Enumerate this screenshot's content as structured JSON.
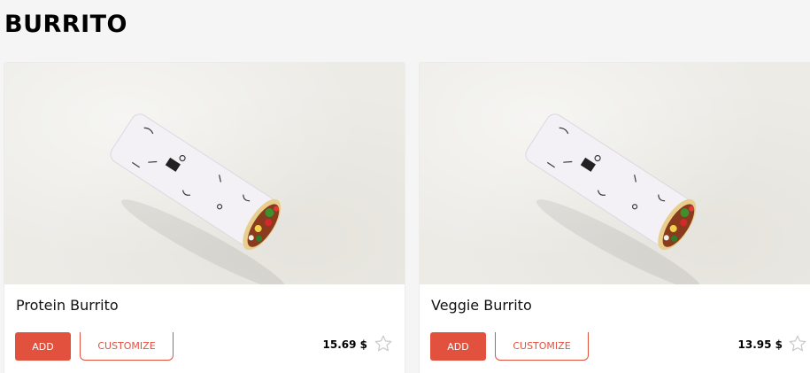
{
  "section": {
    "title": "BURRITO"
  },
  "products": [
    {
      "name": "Protein Burrito",
      "add_label": "ADD",
      "customize_label": "CUSTOMIZE",
      "price": "15.69 $",
      "image_alt": "burrito-photo",
      "favorite_icon": "star-outline-icon"
    },
    {
      "name": "Veggie Burrito",
      "add_label": "ADD",
      "customize_label": "CUSTOMIZE",
      "price": "13.95 $",
      "image_alt": "burrito-photo",
      "favorite_icon": "star-outline-icon"
    }
  ],
  "colors": {
    "accent": "#e2513e",
    "background": "#f5f5f5",
    "card": "#ffffff"
  }
}
